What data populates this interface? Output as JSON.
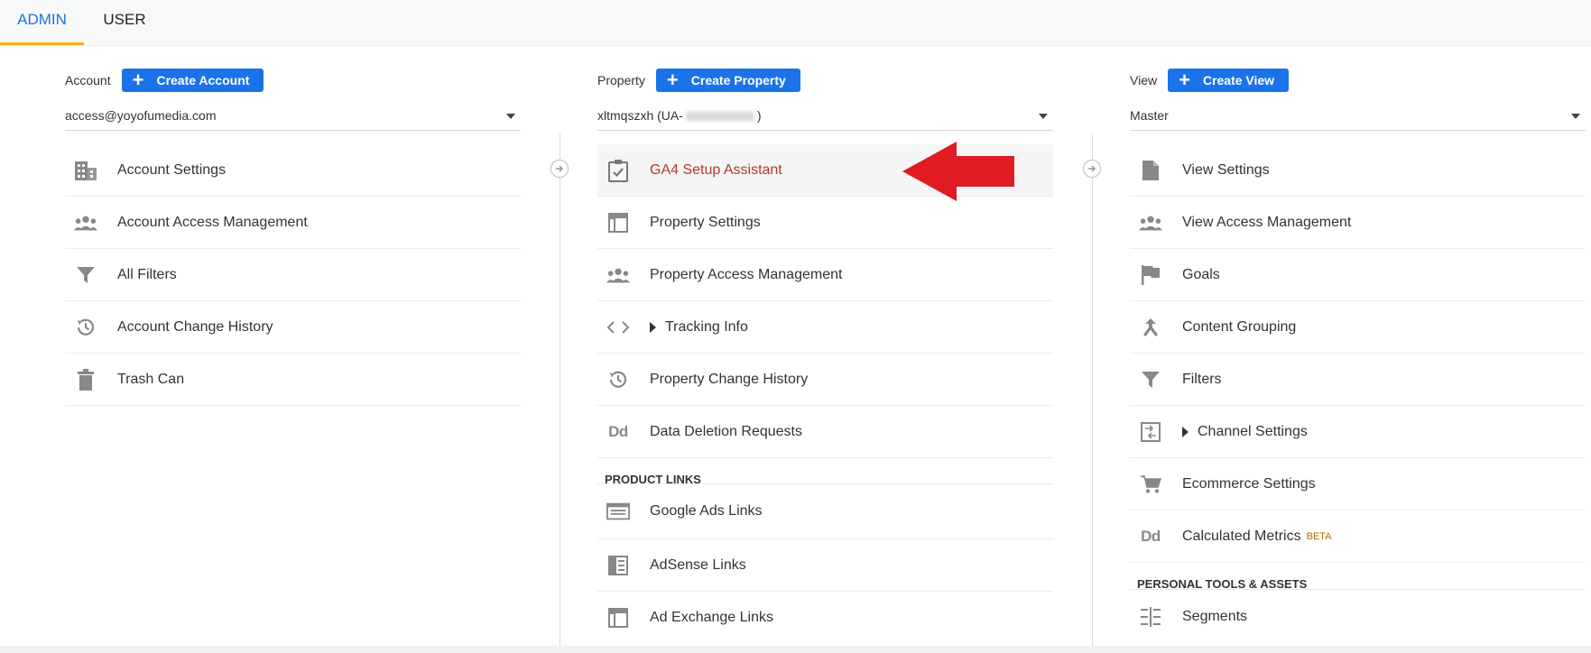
{
  "tabs": [
    {
      "label": "ADMIN",
      "active": true
    },
    {
      "label": "USER",
      "active": false
    }
  ],
  "colors": {
    "accent": "#1a73e8",
    "active_tab_underline": "#f4b400",
    "highlight_text": "#b03a2e",
    "arrow": "#e01b24"
  },
  "account": {
    "label": "Account",
    "create_label": "Create Account",
    "selected": "access@yoyofumedia.com",
    "items": [
      {
        "label": "Account Settings",
        "icon": "building-icon"
      },
      {
        "label": "Account Access Management",
        "icon": "people-icon"
      },
      {
        "label": "All Filters",
        "icon": "filter-icon"
      },
      {
        "label": "Account Change History",
        "icon": "history-icon"
      },
      {
        "label": "Trash Can",
        "icon": "trash-icon"
      }
    ]
  },
  "property": {
    "label": "Property",
    "create_label": "Create Property",
    "selected_prefix": "xltmqszxh (UA-",
    "selected_suffix": ")",
    "items": [
      {
        "label": "GA4 Setup Assistant",
        "icon": "clipboard-check-icon",
        "highlighted": true
      },
      {
        "label": "Property Settings",
        "icon": "layout-icon"
      },
      {
        "label": "Property Access Management",
        "icon": "people-icon"
      },
      {
        "label": "Tracking Info",
        "icon": "code-icon",
        "expandable": true
      },
      {
        "label": "Property Change History",
        "icon": "history-icon"
      },
      {
        "label": "Data Deletion Requests",
        "icon": "dd-icon",
        "icon_text": "Dd"
      }
    ],
    "section": "PRODUCT LINKS",
    "links": [
      {
        "label": "Google Ads Links",
        "icon": "ads-icon"
      },
      {
        "label": "AdSense Links",
        "icon": "adsense-icon"
      },
      {
        "label": "Ad Exchange Links",
        "icon": "layout-icon"
      }
    ]
  },
  "view": {
    "label": "View",
    "create_label": "Create View",
    "selected": "Master",
    "items": [
      {
        "label": "View Settings",
        "icon": "document-icon"
      },
      {
        "label": "View Access Management",
        "icon": "people-icon"
      },
      {
        "label": "Goals",
        "icon": "flag-icon"
      },
      {
        "label": "Content Grouping",
        "icon": "merge-icon"
      },
      {
        "label": "Filters",
        "icon": "filter-icon"
      },
      {
        "label": "Channel Settings",
        "icon": "channel-icon",
        "expandable": true
      },
      {
        "label": "Ecommerce Settings",
        "icon": "cart-icon"
      },
      {
        "label": "Calculated Metrics",
        "icon": "dd-icon",
        "icon_text": "Dd",
        "badge": "BETA"
      }
    ],
    "section": "PERSONAL TOOLS & ASSETS",
    "tools": [
      {
        "label": "Segments",
        "icon": "segments-icon"
      }
    ]
  }
}
